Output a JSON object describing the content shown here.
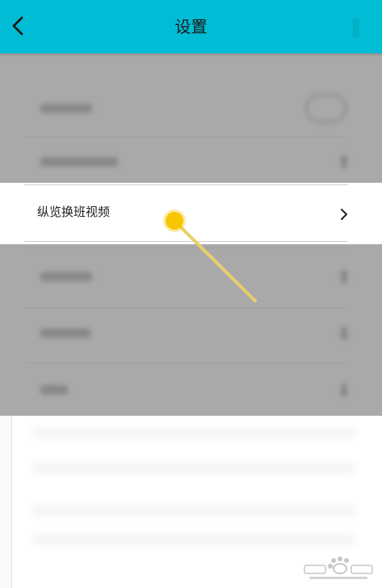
{
  "header": {
    "title": "设置"
  },
  "focused_row": {
    "label": "纵览换班视频"
  },
  "colors": {
    "header_bg": "#00bcd4",
    "dim_overlay": "#a9a9a9",
    "pointer_fill": "#f7c600",
    "pointer_line": "#e8cf6a"
  },
  "icons": {
    "back": "chevron-left-icon",
    "row_arrow": "chevron-right-icon",
    "pointer": "tap-pointer-icon",
    "watermark": "baidu-paw-logo"
  }
}
